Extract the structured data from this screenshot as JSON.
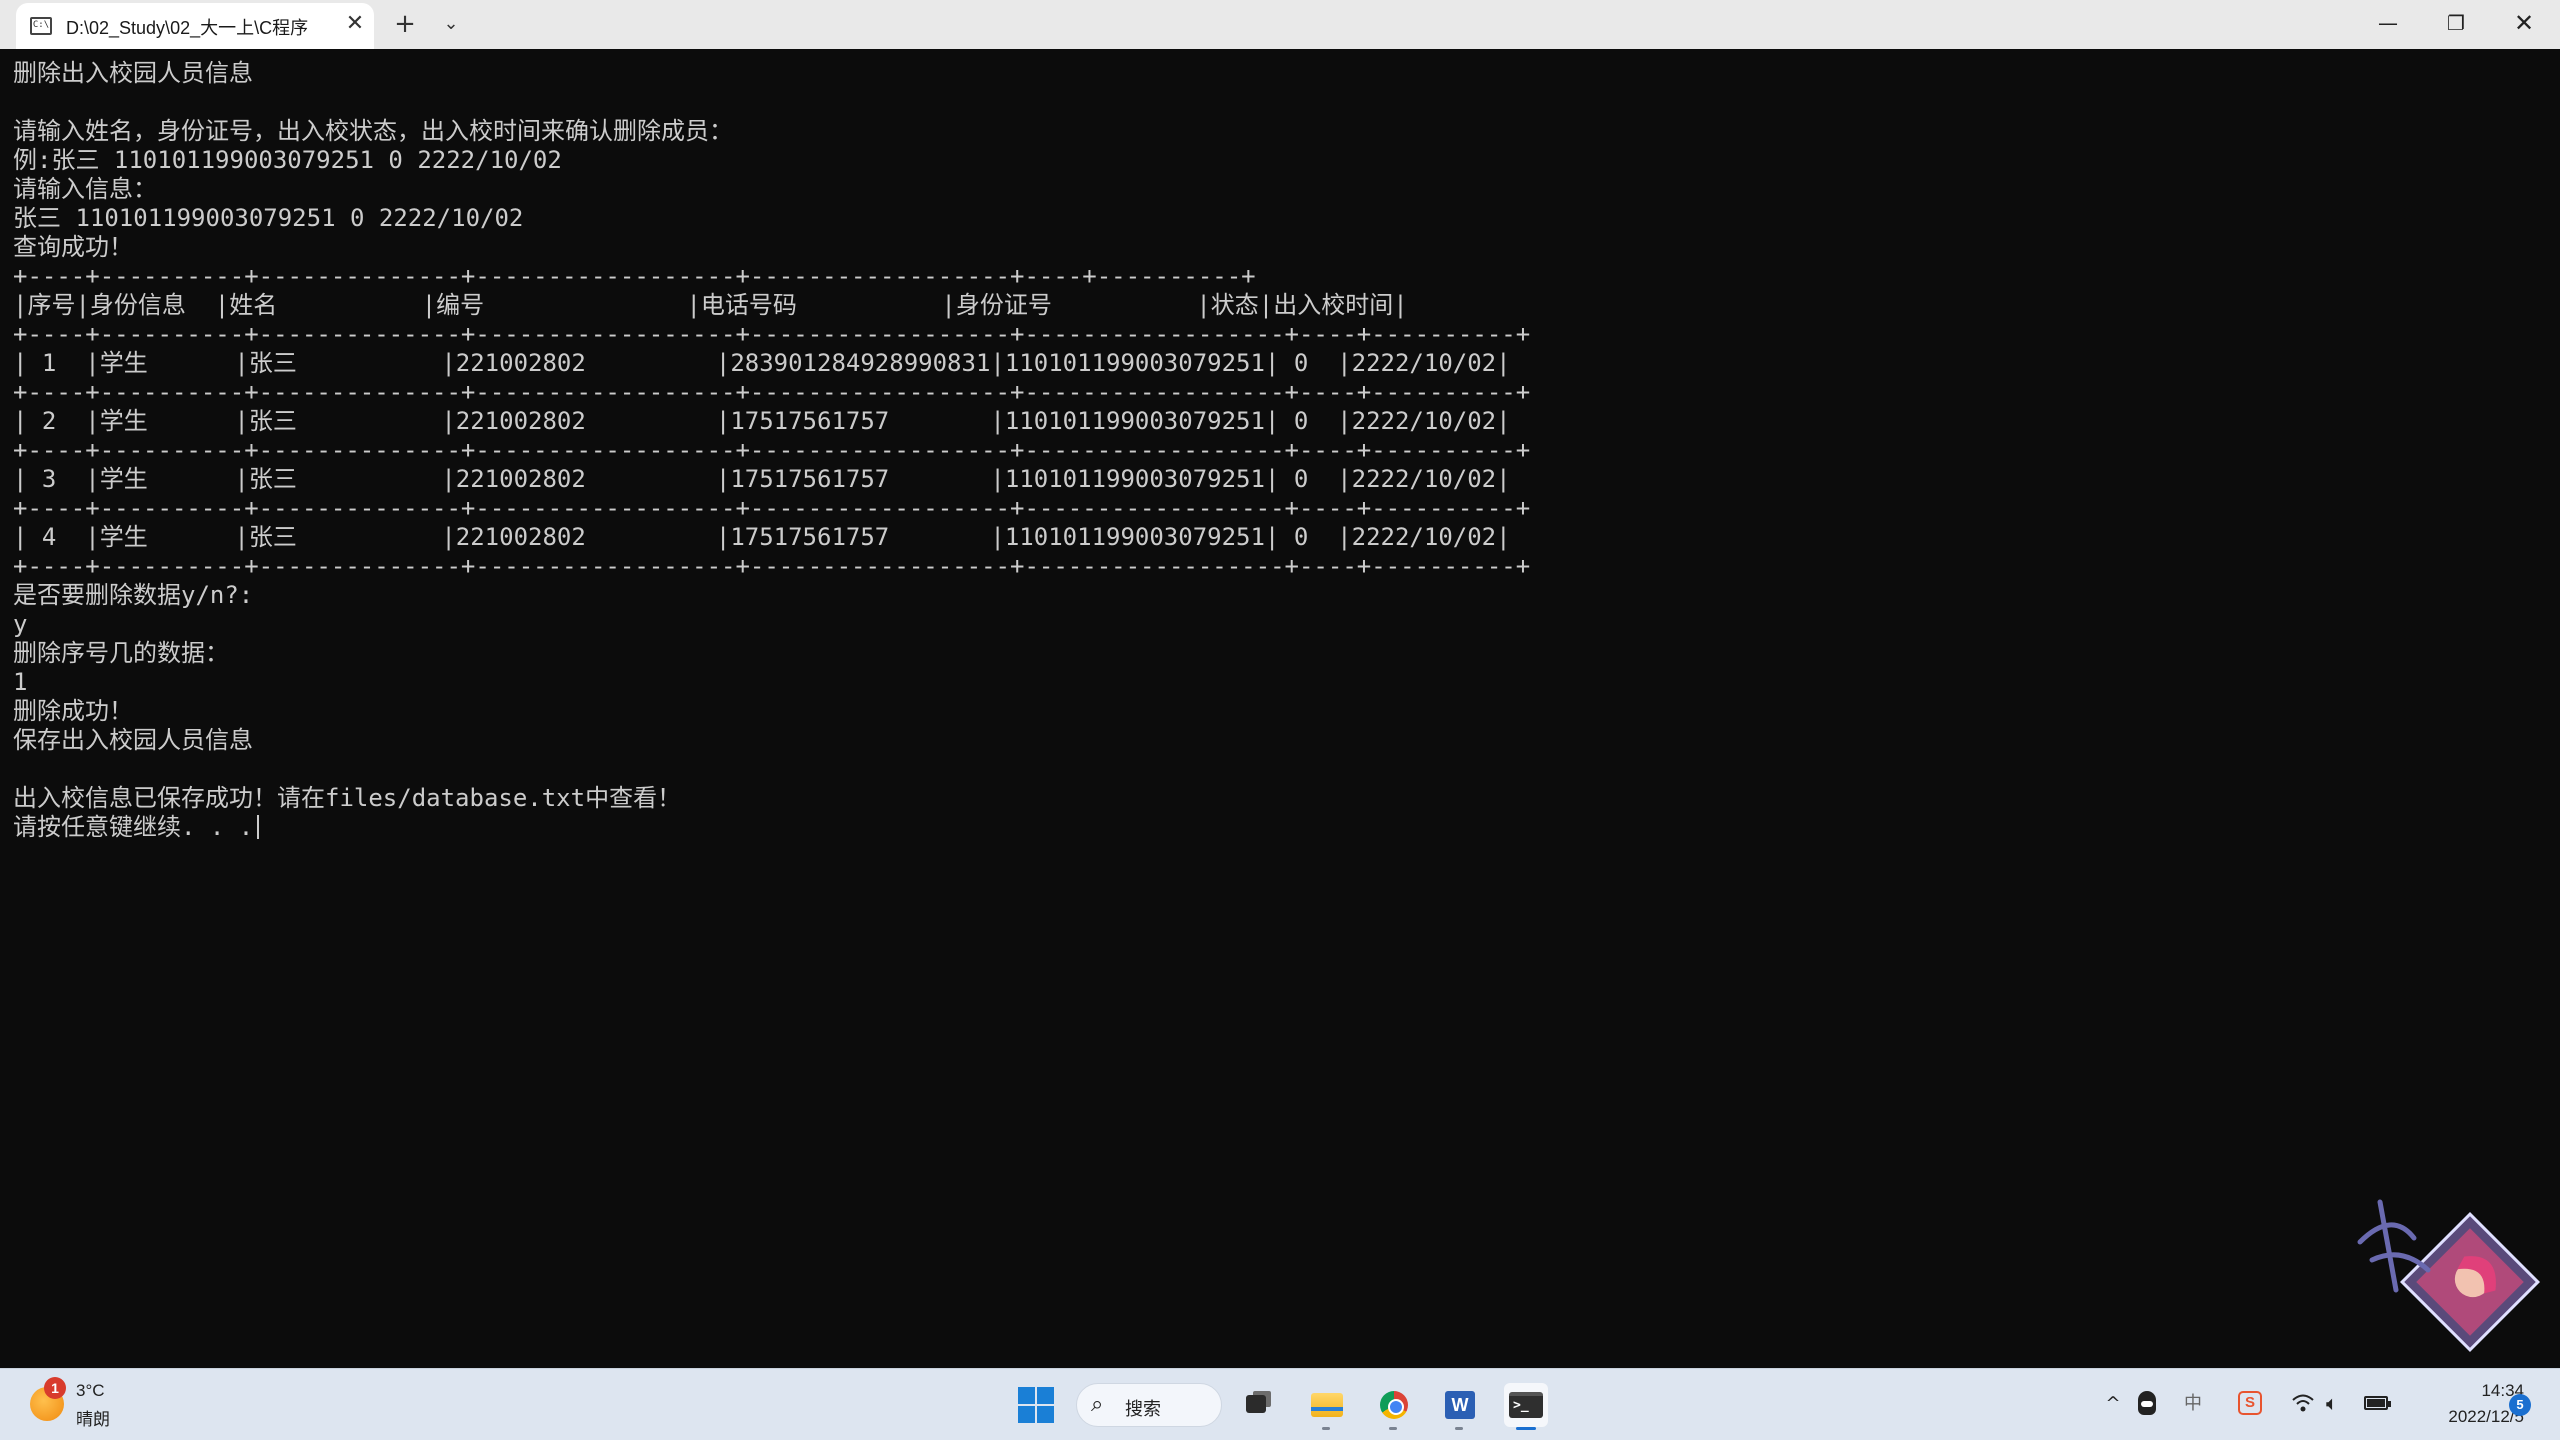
{
  "window": {
    "tab_title": "D:\\02_Study\\02_大一上\\C程序",
    "tab_icon": "console-icon",
    "tab_close": "✕",
    "new_tab": "+",
    "tab_menu": "⌄",
    "minimize": "—",
    "maximize": "❐",
    "close": "✕"
  },
  "console": {
    "lines": [
      "删除出入校园人员信息",
      "",
      "请输入姓名，身份证号，出入校状态，出入校时间来确认删除成员：",
      "例:张三 110101199003079251 0 2222/10/02",
      "请输入信息：",
      "张三 110101199003079251 0 2222/10/02",
      "查询成功！",
      "+----+----------+--------------+------------------+------------------+----+----------+",
      "|序号|身份信息  |姓名          |编号              |电话号码          |身份证号          |状态|出入校时间|",
      "+----+----------+--------------+------------------+------------------+------------------+----+----------+",
      "| 1  |学生      |张三          |221002802         |283901284928990831|110101199003079251| 0  |2222/10/02|",
      "+----+----------+--------------+------------------+------------------+------------------+----+----------+",
      "| 2  |学生      |张三          |221002802         |17517561757       |110101199003079251| 0  |2222/10/02|",
      "+----+----------+--------------+------------------+------------------+------------------+----+----------+",
      "| 3  |学生      |张三          |221002802         |17517561757       |110101199003079251| 0  |2222/10/02|",
      "+----+----------+--------------+------------------+------------------+------------------+----+----------+",
      "| 4  |学生      |张三          |221002802         |17517561757       |110101199003079251| 0  |2222/10/02|",
      "+----+----------+--------------+------------------+------------------+------------------+----+----------+",
      "是否要删除数据y/n?:",
      "y",
      "删除序号几的数据：",
      "1",
      "删除成功！",
      "保存出入校园人员信息",
      "",
      "出入校信息已保存成功！请在files/database.txt中查看！",
      "请按任意键继续. . ."
    ]
  },
  "taskbar": {
    "weather": {
      "badge": "1",
      "temperature": "3°C",
      "condition": "晴朗"
    },
    "search_label": "搜索",
    "apps": [
      "task-view",
      "file-explorer",
      "chrome",
      "word",
      "terminal"
    ],
    "tray": {
      "chevron": "^",
      "ime": "中"
    },
    "clock": {
      "time": "14:34",
      "date": "2022/12/5"
    },
    "notifications": "5"
  },
  "colors": {
    "console_bg": "#0c0c0c",
    "console_fg": "#cccccc",
    "accent": "#1a6fd0"
  }
}
